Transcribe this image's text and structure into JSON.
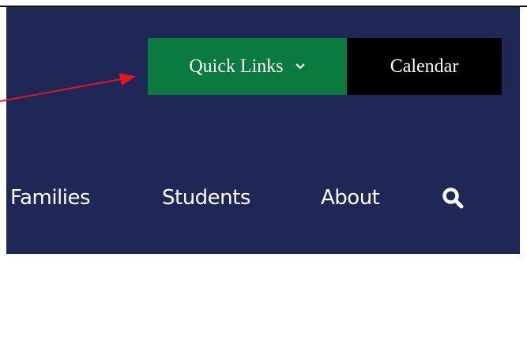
{
  "header": {
    "background_color": "#1e2756",
    "quick_links_label": "Quick Links",
    "quick_links_color": "#0a7a3f",
    "calendar_label": "Calendar",
    "calendar_color": "#000000"
  },
  "nav": {
    "items": [
      {
        "label": "Families"
      },
      {
        "label": "Students"
      },
      {
        "label": "About"
      }
    ],
    "search_icon": "search-icon"
  },
  "annotation": {
    "arrow_color": "#e8141b"
  }
}
